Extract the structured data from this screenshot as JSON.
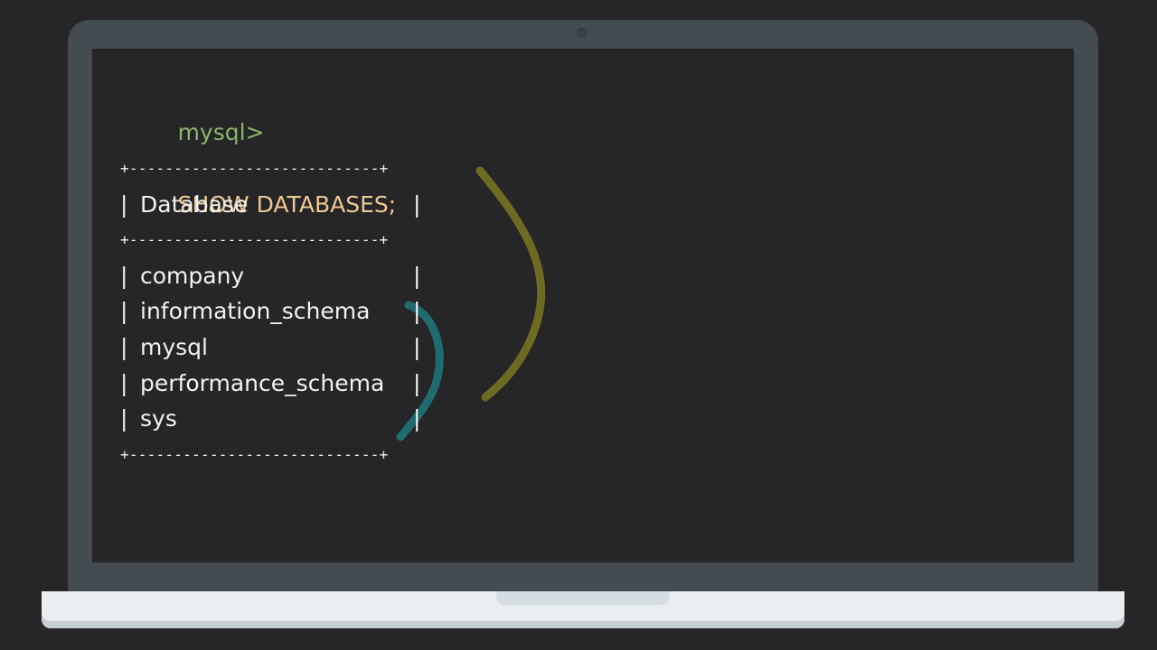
{
  "terminal": {
    "prompt": "mysql>",
    "command": "SHOW DATABASES;",
    "table_border": "+----------------------------+",
    "header": "Database",
    "rows": [
      "company",
      "information_schema",
      "mysql",
      "performance_schema",
      "sys"
    ]
  },
  "colors": {
    "background": "#262527",
    "laptop_frame": "#444b51",
    "prompt": "#8db56a",
    "command": "#f0c891",
    "text": "#f2f2f2",
    "olive_marker": "#6d6b22",
    "teal_marker": "#1f6b70"
  },
  "icons": {
    "camera": "camera-icon"
  }
}
